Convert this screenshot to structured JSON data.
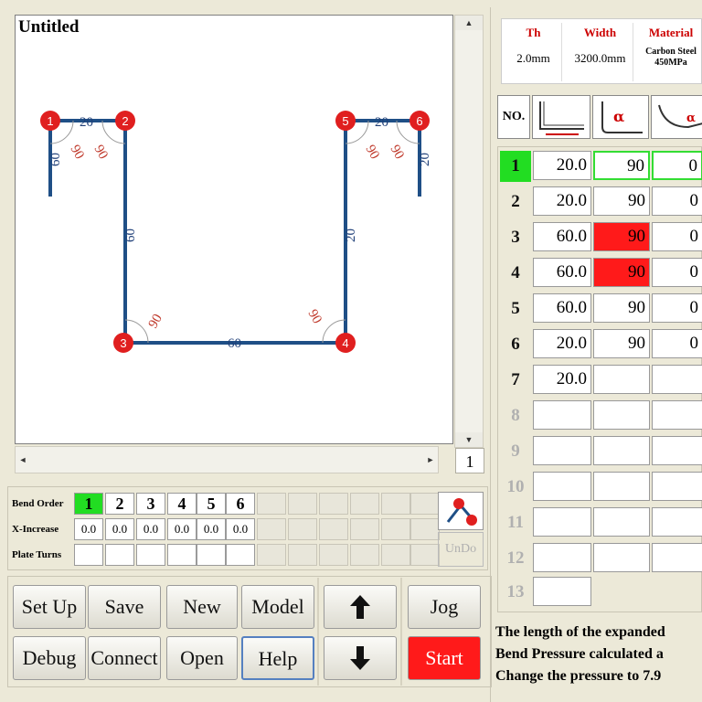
{
  "canvas": {
    "title": "Untitled",
    "page_number": "1",
    "nodes": [
      "1",
      "2",
      "3",
      "4",
      "5",
      "6"
    ],
    "segment_labels": [
      "20",
      "20",
      "60",
      "60",
      "60",
      "20",
      "20"
    ],
    "angle_labels": [
      "90",
      "90",
      "90",
      "90",
      "90",
      "90"
    ]
  },
  "bend_panel": {
    "labels": {
      "order": "Bend Order",
      "xinc": "X-Increase",
      "turns": "Plate Turns"
    },
    "orders": [
      "1",
      "2",
      "3",
      "4",
      "5",
      "6"
    ],
    "x_increase": [
      "0.0",
      "0.0",
      "0.0",
      "0.0",
      "0.0",
      "0.0"
    ],
    "redo_icon": "redo-bend-icon",
    "undo_label": "UnDo"
  },
  "buttons": {
    "setup": "Set Up",
    "save": "Save",
    "new": "New",
    "model": "Model",
    "debug": "Debug",
    "connect": "Connect",
    "open": "Open",
    "help": "Help",
    "jog": "Jog",
    "start": "Start",
    "up_icon": "arrow-up-icon",
    "down_icon": "arrow-down-icon"
  },
  "params": {
    "th_label": "Th",
    "th_value": "2.0mm",
    "width_label": "Width",
    "width_value": "3200.0mm",
    "material_label": "Material",
    "material_value_1": "Carbon Steel",
    "material_value_2": "450MPa"
  },
  "table": {
    "header_no": "NO.",
    "rows": [
      {
        "no": "1",
        "length": "20.0",
        "angle": "90",
        "third": "0"
      },
      {
        "no": "2",
        "length": "20.0",
        "angle": "90",
        "third": "0"
      },
      {
        "no": "3",
        "length": "60.0",
        "angle": "90",
        "third": "0"
      },
      {
        "no": "4",
        "length": "60.0",
        "angle": "90",
        "third": "0"
      },
      {
        "no": "5",
        "length": "60.0",
        "angle": "90",
        "third": "0"
      },
      {
        "no": "6",
        "length": "20.0",
        "angle": "90",
        "third": "0"
      },
      {
        "no": "7",
        "length": "20.0",
        "angle": "",
        "third": ""
      },
      {
        "no": "8",
        "length": "",
        "angle": "",
        "third": ""
      },
      {
        "no": "9",
        "length": "",
        "angle": "",
        "third": ""
      },
      {
        "no": "10",
        "length": "",
        "angle": "",
        "third": ""
      },
      {
        "no": "11",
        "length": "",
        "angle": "",
        "third": ""
      },
      {
        "no": "12",
        "length": "",
        "angle": "",
        "third": ""
      },
      {
        "no": "13",
        "length": "",
        "angle": "",
        "third": ""
      }
    ]
  },
  "status": {
    "line1": "The length of the expanded",
    "line2": "Bend Pressure calculated a",
    "line3": "Change the pressure to 7.9"
  }
}
